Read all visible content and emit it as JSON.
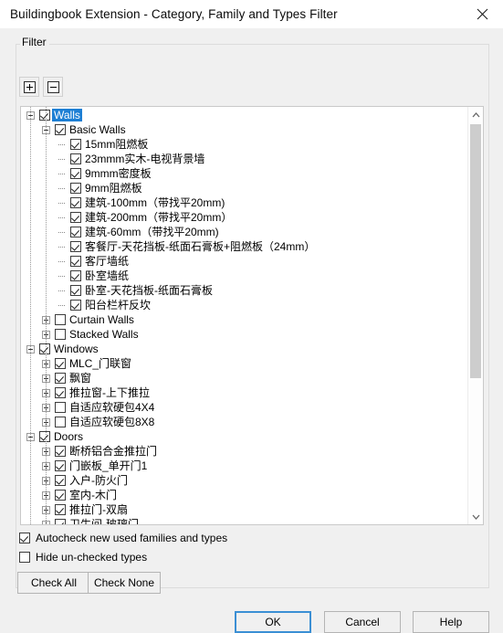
{
  "window": {
    "title": "Buildingbook Extension - Category, Family and Types Filter",
    "close_icon": "close-icon"
  },
  "filter_group": {
    "legend": "Filter",
    "toolbar": {
      "expand_all_icon": "expand-plus-icon",
      "collapse_all_icon": "collapse-minus-icon"
    }
  },
  "tree": {
    "rows": [
      {
        "label": "Walls",
        "level": 0,
        "checked": true,
        "expander": "minus",
        "selected": true
      },
      {
        "label": "Basic Walls",
        "level": 1,
        "checked": true,
        "expander": "minus",
        "selected": false
      },
      {
        "label": "15mm阻燃板",
        "level": 2,
        "checked": true,
        "expander": "none",
        "selected": false
      },
      {
        "label": "23mmm实木-电视背景墙",
        "level": 2,
        "checked": true,
        "expander": "none",
        "selected": false
      },
      {
        "label": "9mmm密度板",
        "level": 2,
        "checked": true,
        "expander": "none",
        "selected": false
      },
      {
        "label": "9mm阻燃板",
        "level": 2,
        "checked": true,
        "expander": "none",
        "selected": false
      },
      {
        "label": "建筑-100mm（带找平20mm)",
        "level": 2,
        "checked": true,
        "expander": "none",
        "selected": false
      },
      {
        "label": "建筑-200mm（带找平20mm）",
        "level": 2,
        "checked": true,
        "expander": "none",
        "selected": false
      },
      {
        "label": "建筑-60mm（带找平20mm)",
        "level": 2,
        "checked": true,
        "expander": "none",
        "selected": false
      },
      {
        "label": "客餐厅-天花挡板-纸面石膏板+阻燃板（24mm）",
        "level": 2,
        "checked": true,
        "expander": "none",
        "selected": false
      },
      {
        "label": "客厅墙纸",
        "level": 2,
        "checked": true,
        "expander": "none",
        "selected": false
      },
      {
        "label": "卧室墙纸",
        "level": 2,
        "checked": true,
        "expander": "none",
        "selected": false
      },
      {
        "label": "卧室-天花挡板-纸面石膏板",
        "level": 2,
        "checked": true,
        "expander": "none",
        "selected": false
      },
      {
        "label": "阳台栏杆反坎",
        "level": 2,
        "checked": true,
        "expander": "none",
        "selected": false
      },
      {
        "label": "Curtain Walls",
        "level": 1,
        "checked": false,
        "expander": "plus",
        "selected": false
      },
      {
        "label": "Stacked Walls",
        "level": 1,
        "checked": false,
        "expander": "plus",
        "selected": false
      },
      {
        "label": "Windows",
        "level": 0,
        "checked": true,
        "expander": "minus",
        "selected": false
      },
      {
        "label": "MLC_门联窗",
        "level": 1,
        "checked": true,
        "expander": "plus",
        "selected": false
      },
      {
        "label": "飘窗",
        "level": 1,
        "checked": true,
        "expander": "plus",
        "selected": false
      },
      {
        "label": "推拉窗-上下推拉",
        "level": 1,
        "checked": true,
        "expander": "plus",
        "selected": false
      },
      {
        "label": "自适应软硬包4X4",
        "level": 1,
        "checked": false,
        "expander": "plus",
        "selected": false
      },
      {
        "label": "自适应软硬包8X8",
        "level": 1,
        "checked": false,
        "expander": "plus",
        "selected": false
      },
      {
        "label": "Doors",
        "level": 0,
        "checked": true,
        "expander": "minus",
        "selected": false
      },
      {
        "label": "断桥铝合金推拉门",
        "level": 1,
        "checked": true,
        "expander": "plus",
        "selected": false
      },
      {
        "label": "门嵌板_单开门1",
        "level": 1,
        "checked": true,
        "expander": "plus",
        "selected": false
      },
      {
        "label": "入户-防火门",
        "level": 1,
        "checked": true,
        "expander": "plus",
        "selected": false
      },
      {
        "label": "室内-木门",
        "level": 1,
        "checked": true,
        "expander": "plus",
        "selected": false
      },
      {
        "label": "推拉门-双扇",
        "level": 1,
        "checked": true,
        "expander": "plus",
        "selected": false
      },
      {
        "label": "卫生间-玻璃门",
        "level": 1,
        "checked": true,
        "expander": "plus",
        "selected": false
      }
    ],
    "scrollbar": {
      "up_arrow_icon": "chevron-up-icon",
      "down_arrow_icon": "chevron-down-icon"
    }
  },
  "options": {
    "autocheck": {
      "label": "Autocheck new used families and types",
      "checked": true
    },
    "hide_unchecked": {
      "label": "Hide un-checked types",
      "checked": false
    }
  },
  "actions": {
    "check_all": "Check All",
    "check_none": "Check None"
  },
  "footer": {
    "ok": "OK",
    "cancel": "Cancel",
    "help": "Help"
  },
  "colors": {
    "selection_blue": "#1d7fd4",
    "focus_border": "#3b8fd4",
    "dialog_bg": "#f0f0f0",
    "panel_bg": "#ffffff",
    "scroll_thumb": "#cdcdcd"
  }
}
